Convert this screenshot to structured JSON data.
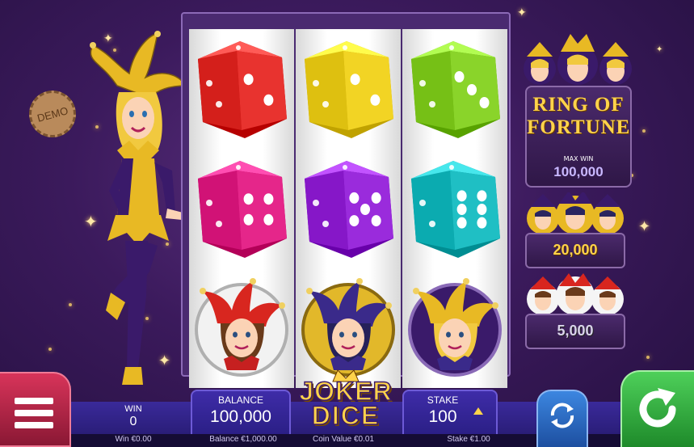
{
  "demo_badge": "DEMO",
  "jackpot": {
    "title_line1": "RING OF",
    "title_line2": "FORTUNE",
    "max_win_label": "MAX WIN",
    "max_win_value": "100,000",
    "tier2_value": "20,000",
    "tier3_value": "5,000"
  },
  "reels": [
    {
      "top": {
        "type": "die",
        "color": "#e8332f",
        "pips": 2
      },
      "middle": {
        "type": "die",
        "color": "#e5268a",
        "pips": 4
      },
      "bottom": {
        "type": "jester",
        "theme": "red"
      }
    },
    {
      "top": {
        "type": "die",
        "color": "#f2d424",
        "pips": 2
      },
      "middle": {
        "type": "die",
        "color": "#9a2bdc",
        "pips": 5
      },
      "bottom": {
        "type": "jester",
        "theme": "purple"
      }
    },
    {
      "top": {
        "type": "die",
        "color": "#8ad42a",
        "pips": 3
      },
      "middle": {
        "type": "die",
        "color": "#1fbfc4",
        "pips": 6
      },
      "bottom": {
        "type": "jester",
        "theme": "gold"
      }
    }
  ],
  "logo": {
    "line1": "JOKER",
    "line2": "DICE"
  },
  "bottom_bar": {
    "win_label": "WIN",
    "win_value": "0",
    "balance_label": "BALANCE",
    "balance_value": "100,000",
    "stake_label": "STAKE",
    "stake_value": "100"
  },
  "status_bar": {
    "win_text": "Win €0.00",
    "balance_text": "Balance €1,000.00",
    "coin_value_text": "Coin Value €0.01",
    "stake_text": "Stake €1.00"
  },
  "colors": {
    "menu_button": "#b0243f",
    "autoplay_button": "#2c6fc9",
    "spin_button": "#2fae3c",
    "gold": "#ffd34a"
  }
}
